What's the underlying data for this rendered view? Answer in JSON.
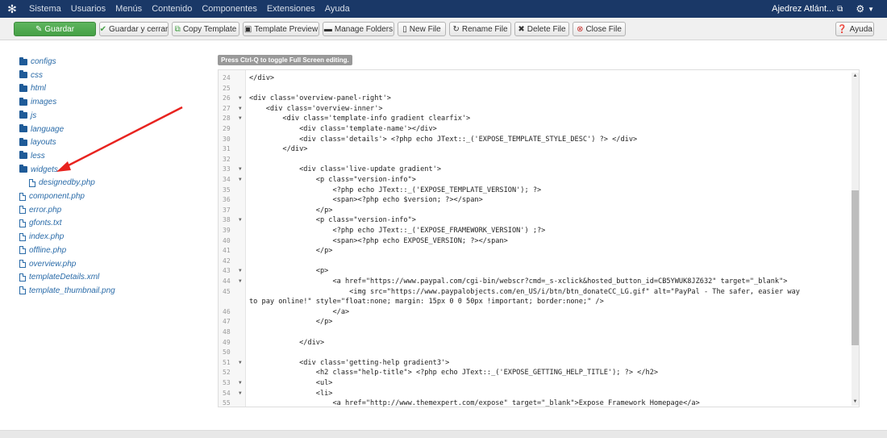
{
  "navbar": {
    "menu": [
      "Sistema",
      "Usuarios",
      "Menús",
      "Contenido",
      "Componentes",
      "Extensiones",
      "Ayuda"
    ],
    "site_name": "Ajedrez Atlánt...",
    "logo_icon": "joomla-icon",
    "gear_icon": "gear-icon"
  },
  "toolbar": {
    "save": "Guardar",
    "save_close": "Guardar y cerrar",
    "copy_template": "Copy Template",
    "template_preview": "Template Preview",
    "manage_folders": "Manage Folders",
    "new_file": "New File",
    "rename_file": "Rename File",
    "delete_file": "Delete File",
    "close_file": "Close File",
    "help": "Ayuda"
  },
  "tree": {
    "folders": [
      "configs",
      "css",
      "html",
      "images",
      "js",
      "language",
      "layouts",
      "less",
      "widgets"
    ],
    "widget_child": "designedby.php",
    "files": [
      "component.php",
      "error.php",
      "gfonts.txt",
      "index.php",
      "offline.php",
      "overview.php",
      "templateDetails.xml",
      "template_thumbnail.png"
    ]
  },
  "editor": {
    "hint": "Press Ctrl-Q to toggle Full Screen editing.",
    "lines": [
      {
        "n": "24",
        "fold": false,
        "code": "</div>"
      },
      {
        "n": "25",
        "fold": false,
        "code": ""
      },
      {
        "n": "26",
        "fold": true,
        "code": "<div class='overview-panel-right'>"
      },
      {
        "n": "27",
        "fold": true,
        "code": "    <div class='overview-inner'>"
      },
      {
        "n": "28",
        "fold": true,
        "code": "        <div class='template-info gradient clearfix'>"
      },
      {
        "n": "29",
        "fold": false,
        "code": "            <div class='template-name'></div>"
      },
      {
        "n": "30",
        "fold": false,
        "code": "            <div class='details'> <?php echo JText::_('EXPOSE_TEMPLATE_STYLE_DESC') ?> </div>"
      },
      {
        "n": "31",
        "fold": false,
        "code": "        </div>"
      },
      {
        "n": "32",
        "fold": false,
        "code": ""
      },
      {
        "n": "33",
        "fold": true,
        "code": "            <div class='live-update gradient'>"
      },
      {
        "n": "34",
        "fold": true,
        "code": "                <p class=\"version-info\">"
      },
      {
        "n": "35",
        "fold": false,
        "code": "                    <?php echo JText::_('EXPOSE_TEMPLATE_VERSION'); ?>"
      },
      {
        "n": "36",
        "fold": false,
        "code": "                    <span><?php echo $version; ?></span>"
      },
      {
        "n": "37",
        "fold": false,
        "code": "                </p>"
      },
      {
        "n": "38",
        "fold": true,
        "code": "                <p class=\"version-info\">"
      },
      {
        "n": "39",
        "fold": false,
        "code": "                    <?php echo JText::_('EXPOSE_FRAMEWORK_VERSION') ;?>"
      },
      {
        "n": "40",
        "fold": false,
        "code": "                    <span><?php echo EXPOSE_VERSION; ?></span>"
      },
      {
        "n": "41",
        "fold": false,
        "code": "                </p>"
      },
      {
        "n": "42",
        "fold": false,
        "code": ""
      },
      {
        "n": "43",
        "fold": true,
        "code": "                <p>"
      },
      {
        "n": "44",
        "fold": true,
        "code": "                    <a href=\"https://www.paypal.com/cgi-bin/webscr?cmd=_s-xclick&hosted_button_id=CB5YWUK8JZ632\" target=\"_blank\">"
      },
      {
        "n": "45",
        "fold": false,
        "code": "                        <img src=\"https://www.paypalobjects.com/en_US/i/btn/btn_donateCC_LG.gif\" alt=\"PayPal - The safer, easier way"
      },
      {
        "n": "",
        "fold": false,
        "code": "to pay online!\" style=\"float:none; margin: 15px 0 0 50px !important; border:none;\" />"
      },
      {
        "n": "46",
        "fold": false,
        "code": "                    </a>"
      },
      {
        "n": "47",
        "fold": false,
        "code": "                </p>"
      },
      {
        "n": "48",
        "fold": false,
        "code": ""
      },
      {
        "n": "49",
        "fold": false,
        "code": "            </div>"
      },
      {
        "n": "50",
        "fold": false,
        "code": ""
      },
      {
        "n": "51",
        "fold": true,
        "code": "            <div class='getting-help gradient3'>"
      },
      {
        "n": "52",
        "fold": false,
        "code": "                <h2 class=\"help-title\"> <?php echo JText::_('EXPOSE_GETTING_HELP_TITLE'); ?> </h2>"
      },
      {
        "n": "53",
        "fold": true,
        "code": "                <ul>"
      },
      {
        "n": "54",
        "fold": true,
        "code": "                <li>"
      },
      {
        "n": "55",
        "fold": false,
        "code": "                    <a href=\"http://www.themexpert.com/expose\" target=\"_blank\">Expose Framework Homepage</a>"
      }
    ]
  },
  "colors": {
    "navbar_bg": "#1a3867",
    "save_green": "#46a046",
    "link_blue": "#2a6ba8",
    "arrow_red": "#e8231f"
  }
}
